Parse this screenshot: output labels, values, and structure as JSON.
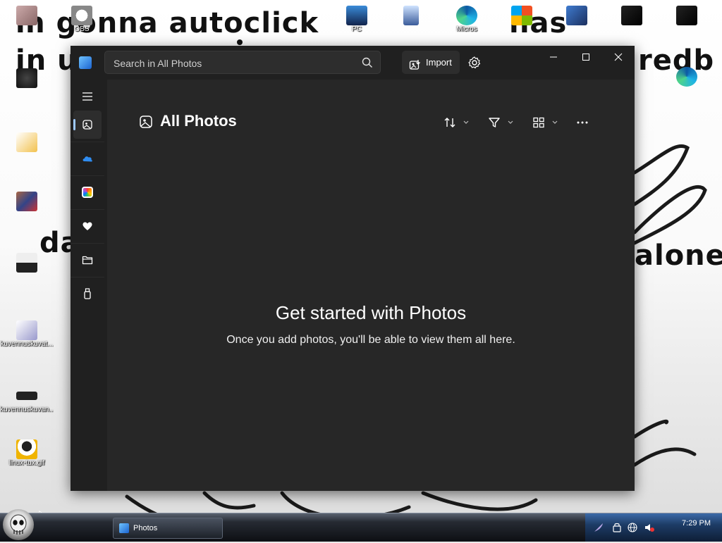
{
  "wallpaper": {
    "line1": "m gonna autoclick",
    "line1b": "has",
    "line2": "in u",
    "line2b": "redb",
    "line3a": "da",
    "line3b": "alone"
  },
  "desktop_icons": [
    {
      "label": "",
      "icon": "photo-file-icon"
    },
    {
      "label": "",
      "icon": "photo-file-icon"
    },
    {
      "label": "",
      "icon": "fox-file-icon"
    },
    {
      "label": "",
      "icon": "photo-file-icon"
    },
    {
      "label": "",
      "icon": "text-file-icon"
    },
    {
      "label": "kuvennuskuvat...",
      "icon": "image-file-icon"
    },
    {
      "label": "kuvennuskuvan...",
      "icon": "image-file-icon"
    },
    {
      "label": "linux-tux.gif",
      "icon": "tux-icon"
    },
    {
      "label": "OBS",
      "icon": "obs-icon"
    },
    {
      "label": "PC",
      "icon": "computer-icon"
    },
    {
      "label": "",
      "icon": "recycle-bin-icon"
    },
    {
      "label": "Micros",
      "icon": "edge-icon"
    },
    {
      "label": "",
      "icon": "app-icon"
    },
    {
      "label": "",
      "icon": "app-icon"
    },
    {
      "label": "",
      "icon": "app-icon"
    },
    {
      "label": "",
      "icon": "app-icon"
    },
    {
      "label": "",
      "icon": "edge-icon"
    }
  ],
  "window": {
    "search_placeholder": "Search in All Photos",
    "import_label": "Import",
    "page_title": "All Photos",
    "empty_title": "Get started with Photos",
    "empty_subtitle": "Once you add photos, you'll be able to view them all here.",
    "sidebar": [
      {
        "name": "nav-menu",
        "icon": "hamburger-icon"
      },
      {
        "name": "nav-all-photos",
        "icon": "photos-icon",
        "active": true
      },
      {
        "name": "nav-onedrive",
        "icon": "onedrive-icon"
      },
      {
        "name": "nav-icloud",
        "icon": "icloud-photos-icon"
      },
      {
        "name": "nav-favorites",
        "icon": "heart-icon"
      },
      {
        "name": "nav-folders",
        "icon": "folder-icon"
      },
      {
        "name": "nav-external",
        "icon": "usb-drive-icon"
      }
    ],
    "colors": {
      "bg": "#202020",
      "content": "#272727",
      "accent": "#9ec9ff"
    }
  },
  "taskbar": {
    "task_label": "Photos",
    "clock": "7:29 PM"
  }
}
